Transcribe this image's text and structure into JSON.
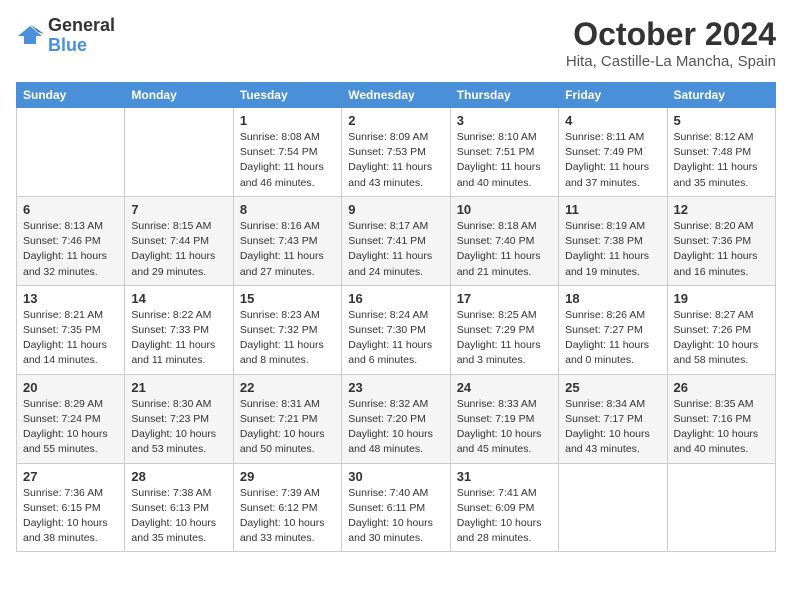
{
  "logo": {
    "general": "General",
    "blue": "Blue"
  },
  "header": {
    "month": "October 2024",
    "location": "Hita, Castille-La Mancha, Spain"
  },
  "weekdays": [
    "Sunday",
    "Monday",
    "Tuesday",
    "Wednesday",
    "Thursday",
    "Friday",
    "Saturday"
  ],
  "weeks": [
    [
      {
        "day": "",
        "info": ""
      },
      {
        "day": "",
        "info": ""
      },
      {
        "day": "1",
        "info": "Sunrise: 8:08 AM\nSunset: 7:54 PM\nDaylight: 11 hours and 46 minutes."
      },
      {
        "day": "2",
        "info": "Sunrise: 8:09 AM\nSunset: 7:53 PM\nDaylight: 11 hours and 43 minutes."
      },
      {
        "day": "3",
        "info": "Sunrise: 8:10 AM\nSunset: 7:51 PM\nDaylight: 11 hours and 40 minutes."
      },
      {
        "day": "4",
        "info": "Sunrise: 8:11 AM\nSunset: 7:49 PM\nDaylight: 11 hours and 37 minutes."
      },
      {
        "day": "5",
        "info": "Sunrise: 8:12 AM\nSunset: 7:48 PM\nDaylight: 11 hours and 35 minutes."
      }
    ],
    [
      {
        "day": "6",
        "info": "Sunrise: 8:13 AM\nSunset: 7:46 PM\nDaylight: 11 hours and 32 minutes."
      },
      {
        "day": "7",
        "info": "Sunrise: 8:15 AM\nSunset: 7:44 PM\nDaylight: 11 hours and 29 minutes."
      },
      {
        "day": "8",
        "info": "Sunrise: 8:16 AM\nSunset: 7:43 PM\nDaylight: 11 hours and 27 minutes."
      },
      {
        "day": "9",
        "info": "Sunrise: 8:17 AM\nSunset: 7:41 PM\nDaylight: 11 hours and 24 minutes."
      },
      {
        "day": "10",
        "info": "Sunrise: 8:18 AM\nSunset: 7:40 PM\nDaylight: 11 hours and 21 minutes."
      },
      {
        "day": "11",
        "info": "Sunrise: 8:19 AM\nSunset: 7:38 PM\nDaylight: 11 hours and 19 minutes."
      },
      {
        "day": "12",
        "info": "Sunrise: 8:20 AM\nSunset: 7:36 PM\nDaylight: 11 hours and 16 minutes."
      }
    ],
    [
      {
        "day": "13",
        "info": "Sunrise: 8:21 AM\nSunset: 7:35 PM\nDaylight: 11 hours and 14 minutes."
      },
      {
        "day": "14",
        "info": "Sunrise: 8:22 AM\nSunset: 7:33 PM\nDaylight: 11 hours and 11 minutes."
      },
      {
        "day": "15",
        "info": "Sunrise: 8:23 AM\nSunset: 7:32 PM\nDaylight: 11 hours and 8 minutes."
      },
      {
        "day": "16",
        "info": "Sunrise: 8:24 AM\nSunset: 7:30 PM\nDaylight: 11 hours and 6 minutes."
      },
      {
        "day": "17",
        "info": "Sunrise: 8:25 AM\nSunset: 7:29 PM\nDaylight: 11 hours and 3 minutes."
      },
      {
        "day": "18",
        "info": "Sunrise: 8:26 AM\nSunset: 7:27 PM\nDaylight: 11 hours and 0 minutes."
      },
      {
        "day": "19",
        "info": "Sunrise: 8:27 AM\nSunset: 7:26 PM\nDaylight: 10 hours and 58 minutes."
      }
    ],
    [
      {
        "day": "20",
        "info": "Sunrise: 8:29 AM\nSunset: 7:24 PM\nDaylight: 10 hours and 55 minutes."
      },
      {
        "day": "21",
        "info": "Sunrise: 8:30 AM\nSunset: 7:23 PM\nDaylight: 10 hours and 53 minutes."
      },
      {
        "day": "22",
        "info": "Sunrise: 8:31 AM\nSunset: 7:21 PM\nDaylight: 10 hours and 50 minutes."
      },
      {
        "day": "23",
        "info": "Sunrise: 8:32 AM\nSunset: 7:20 PM\nDaylight: 10 hours and 48 minutes."
      },
      {
        "day": "24",
        "info": "Sunrise: 8:33 AM\nSunset: 7:19 PM\nDaylight: 10 hours and 45 minutes."
      },
      {
        "day": "25",
        "info": "Sunrise: 8:34 AM\nSunset: 7:17 PM\nDaylight: 10 hours and 43 minutes."
      },
      {
        "day": "26",
        "info": "Sunrise: 8:35 AM\nSunset: 7:16 PM\nDaylight: 10 hours and 40 minutes."
      }
    ],
    [
      {
        "day": "27",
        "info": "Sunrise: 7:36 AM\nSunset: 6:15 PM\nDaylight: 10 hours and 38 minutes."
      },
      {
        "day": "28",
        "info": "Sunrise: 7:38 AM\nSunset: 6:13 PM\nDaylight: 10 hours and 35 minutes."
      },
      {
        "day": "29",
        "info": "Sunrise: 7:39 AM\nSunset: 6:12 PM\nDaylight: 10 hours and 33 minutes."
      },
      {
        "day": "30",
        "info": "Sunrise: 7:40 AM\nSunset: 6:11 PM\nDaylight: 10 hours and 30 minutes."
      },
      {
        "day": "31",
        "info": "Sunrise: 7:41 AM\nSunset: 6:09 PM\nDaylight: 10 hours and 28 minutes."
      },
      {
        "day": "",
        "info": ""
      },
      {
        "day": "",
        "info": ""
      }
    ]
  ]
}
